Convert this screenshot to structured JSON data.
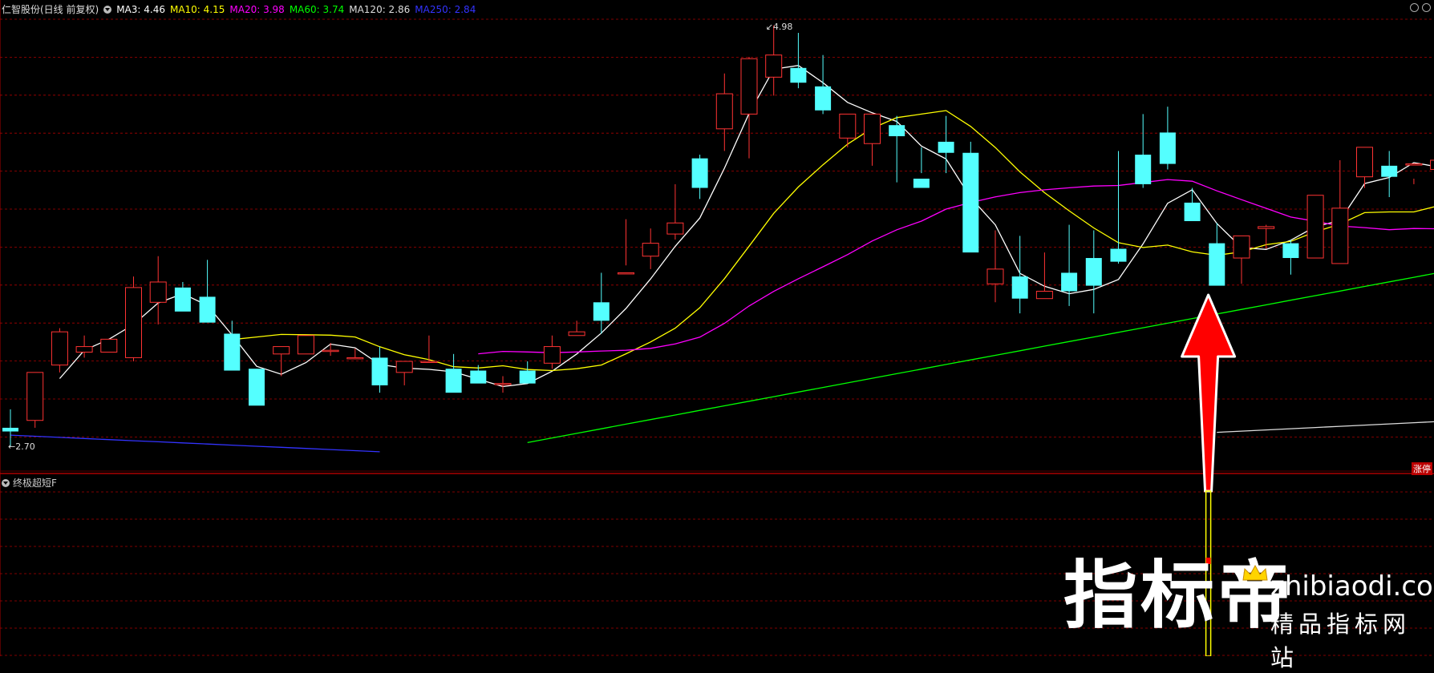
{
  "header": {
    "stock": "仁智股份(日线 前复权)",
    "ma": [
      {
        "label": "MA3: 4.46",
        "color": "#ffffff"
      },
      {
        "label": "MA10: 4.15",
        "color": "#ffff00"
      },
      {
        "label": "MA20: 3.98",
        "color": "#ff00ff"
      },
      {
        "label": "MA60: 3.74",
        "color": "#00ff00"
      },
      {
        "label": "MA120: 2.86",
        "color": "#dddddd"
      },
      {
        "label": "MA250: 2.84",
        "color": "#3333ff"
      }
    ]
  },
  "sub_panel": {
    "title": "终极超短F"
  },
  "badge": "涨停",
  "watermark": {
    "big": "指标帝",
    "url": "zhibiaodi.com",
    "sub": "精品指标网站"
  },
  "colors": {
    "up": "#ff3333",
    "down": "#54ffff",
    "ma3": "#ffffff",
    "ma10": "#ffff00",
    "ma20": "#ff00ff",
    "ma60": "#00ff00",
    "ma120": "#dddddd",
    "ma250": "#3333ff",
    "grid": "#aa0000",
    "arrow": "#ff0000",
    "signal": "#ffff00"
  },
  "chart_data": {
    "type": "candlestick",
    "ylim": [
      2.6,
      5.04
    ],
    "high_label": "4.98",
    "low_label": "2.70",
    "candles": [
      [
        2.8,
        2.9,
        2.7,
        2.78
      ],
      [
        2.84,
        3.1,
        2.8,
        3.1
      ],
      [
        3.14,
        3.34,
        3.1,
        3.32
      ],
      [
        3.21,
        3.3,
        3.18,
        3.24
      ],
      [
        3.21,
        3.28,
        3.22,
        3.28
      ],
      [
        3.18,
        3.62,
        3.16,
        3.56
      ],
      [
        3.48,
        3.73,
        3.36,
        3.59
      ],
      [
        3.56,
        3.59,
        3.56,
        3.43
      ],
      [
        3.51,
        3.71,
        3.44,
        3.37
      ],
      [
        3.31,
        3.38,
        3.14,
        3.11
      ],
      [
        3.12,
        3.2,
        3.2,
        2.92
      ],
      [
        3.2,
        3.21,
        3.08,
        3.24
      ],
      [
        3.2,
        3.3,
        3.2,
        3.3
      ],
      [
        3.22,
        3.26,
        3.19,
        3.22
      ],
      [
        3.18,
        3.23,
        3.18,
        3.18
      ],
      [
        3.18,
        3.24,
        2.99,
        3.03
      ],
      [
        3.1,
        3.14,
        3.03,
        3.16
      ],
      [
        3.16,
        3.3,
        3.16,
        3.16
      ],
      [
        3.12,
        3.2,
        3.12,
        2.99
      ],
      [
        3.11,
        3.14,
        3.06,
        3.04
      ],
      [
        3.04,
        3.08,
        2.99,
        3.04
      ],
      [
        3.11,
        3.16,
        3.06,
        3.04
      ],
      [
        3.15,
        3.3,
        3.12,
        3.24
      ],
      [
        3.3,
        3.38,
        3.3,
        3.32
      ],
      [
        3.48,
        3.64,
        3.31,
        3.38
      ],
      [
        3.64,
        3.93,
        3.68,
        3.64
      ],
      [
        3.73,
        3.88,
        3.66,
        3.8
      ],
      [
        3.85,
        4.12,
        3.82,
        3.91
      ],
      [
        4.26,
        4.28,
        4.04,
        4.1
      ],
      [
        4.42,
        4.72,
        4.3,
        4.61
      ],
      [
        4.5,
        4.81,
        4.26,
        4.8
      ],
      [
        4.7,
        4.98,
        4.6,
        4.82
      ],
      [
        4.75,
        4.94,
        4.64,
        4.67
      ],
      [
        4.65,
        4.82,
        4.5,
        4.52
      ],
      [
        4.37,
        4.44,
        4.32,
        4.5
      ],
      [
        4.34,
        4.4,
        4.22,
        4.5
      ],
      [
        4.44,
        4.49,
        4.13,
        4.38
      ],
      [
        4.15,
        4.32,
        4.18,
        4.1
      ],
      [
        4.35,
        4.49,
        4.18,
        4.29
      ],
      [
        4.29,
        4.35,
        3.88,
        3.75
      ],
      [
        3.58,
        3.87,
        3.48,
        3.66
      ],
      [
        3.62,
        3.84,
        3.42,
        3.5
      ],
      [
        3.5,
        3.75,
        3.52,
        3.54
      ],
      [
        3.64,
        3.9,
        3.46,
        3.54
      ],
      [
        3.72,
        3.87,
        3.42,
        3.57
      ],
      [
        3.77,
        4.3,
        3.69,
        3.7
      ],
      [
        4.28,
        4.5,
        4.1,
        4.12
      ],
      [
        4.4,
        4.54,
        4.2,
        4.23
      ],
      [
        4.02,
        4.1,
        3.96,
        3.92
      ],
      [
        3.8,
        3.91,
        3.66,
        3.57
      ],
      [
        3.72,
        3.78,
        3.58,
        3.84
      ],
      [
        3.88,
        3.9,
        3.77,
        3.89
      ],
      [
        3.8,
        3.82,
        3.63,
        3.72
      ],
      [
        3.72,
        4.04,
        3.72,
        4.06
      ],
      [
        3.69,
        4.25,
        3.86,
        3.99
      ],
      [
        4.16,
        4.2,
        4.1,
        4.32
      ],
      [
        4.22,
        4.3,
        4.05,
        4.16
      ],
      [
        4.23,
        4.15,
        4.12,
        4.23
      ],
      [
        4.2,
        4.3,
        4.12,
        4.25
      ],
      [
        4.32,
        4.43,
        4.2,
        4.18
      ],
      [
        4.21,
        4.36,
        4.16,
        4.28
      ],
      [
        4.3,
        4.42,
        4.16,
        4.2
      ],
      [
        4.66,
        4.94,
        4.52,
        4.88
      ]
    ]
  }
}
